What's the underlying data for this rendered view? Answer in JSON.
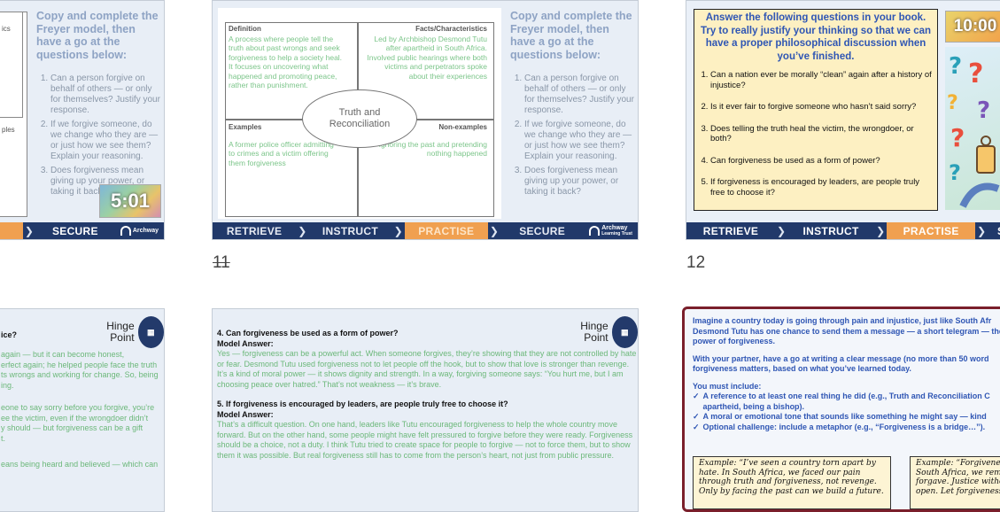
{
  "slide_numbers": {
    "left_mid": "11",
    "right_mid": "12"
  },
  "banner": {
    "retrieve": "RETRIEVE",
    "instruct": "INSTRUCT",
    "practise": "PRACTISE",
    "secure": "SECURE",
    "archway_line1": "Archway",
    "archway_line2": "Learning Trust"
  },
  "slide10": {
    "partial_labels": [
      "ics",
      "ples"
    ],
    "instruction": "Copy and complete the Freyer model, then have a go at the questions below:",
    "questions": [
      "Can a person forgive on behalf of others — or only for themselves? Justify your response.",
      "If we forgive someone, do we change who they are — or just how we see them? Explain your reasoning.",
      "Does forgiveness mean giving up your power, or taking it back?"
    ],
    "timer": "5:01"
  },
  "slide11": {
    "definition_label": "Definition",
    "definition_text": "A process where people tell the truth about past wrongs and seek forgiveness to help a society heal. It focuses on uncovering what happened and promoting peace, rather than punishment.",
    "facts_label": "Facts/Characteristics",
    "facts_text": "Led by Archbishop Desmond Tutu after apartheid in South Africa. Involved public hearings where both victims and perpetrators spoke about their experiences",
    "examples_label": "Examples",
    "examples_text": "A former police officer admitting to crimes and a victim offering them forgiveness",
    "nonexamples_label": "Non-examples",
    "nonexamples_text": "Ignoring the past and pretending nothing happened",
    "centre": "Truth and Reconciliation",
    "instruction": "Copy and complete the Freyer model, then have a go at the questions below:",
    "questions": [
      "Can a person forgive on behalf of others — or only for themselves? Justify your response.",
      "If we forgive someone, do we change who they are — or just how we see them? Explain your reasoning.",
      "Does forgiveness mean giving up your power, or taking it back?"
    ]
  },
  "slide12": {
    "heading": "Answer the following questions in your book. Try to really justify your thinking so that we can have a proper philosophical discussion when you’ve finished.",
    "questions": [
      "Can a nation ever be morally “clean” again after a history of injustice?",
      "Is it ever fair to forgive someone who hasn’t said sorry?",
      "Does telling the truth heal the victim, the wrongdoer, or both?",
      "Can forgiveness be used as a form of power?",
      "If forgiveness is encouraged by leaders, are people truly free to choose it?"
    ],
    "timer": "10:00"
  },
  "slide13": {
    "heading_partial": "ice?",
    "hinge": "Hinge Point",
    "lines": [
      "again — but it can become honest,",
      "erfect again; he helped people face the truth",
      "ts wrongs and working for change. So, being",
      "ing.",
      "",
      "eone to say sorry before you forgive, you’re",
      "ee the victim, even if the wrongdoer didn’t",
      "y should — but forgiveness can be a gift",
      "t.",
      "",
      "eans being heard and believed — which can"
    ]
  },
  "slide14": {
    "hinge": "Hinge Point",
    "q4": "4. Can forgiveness be used as a form of power?",
    "model_label": "Model Answer:",
    "a4": "Yes — forgiveness can be a powerful act. When someone forgives, they’re showing that they are not controlled by hate or fear. Desmond Tutu used forgiveness not to let people off the hook, but to show that love is stronger than revenge. It’s a kind of moral power — it shows dignity and strength. In a way, forgiving someone says: “You hurt me, but I am choosing peace over hatred.” That’s not weakness — it’s brave.",
    "q5": "5. If forgiveness is encouraged by leaders, are people truly free to choose it?",
    "a5": "That’s a difficult question. On one hand, leaders like Tutu encouraged forgiveness to help the whole country move forward. But on the other hand, some people might have felt pressured to forgive before they were ready. Forgiveness should be a choice, not a duty. I think Tutu tried to create space for people to forgive — not to force them, but to show them it was possible. But real forgiveness still has to come from the person’s heart, not just from public pressure."
  },
  "slide15": {
    "p1": "Imagine a country today is going through pain and injustice, just like South Afr Desmond Tutu has one chance to send them a message — a short telegram — the power of forgiveness.",
    "p2": "With your partner, have a go at writing a clear message (no more than 50 word forgiveness matters, based on what you’ve learned today.",
    "must": "You must include:",
    "bullets": [
      "A reference to at least one real thing he did (e.g., Truth and Reconciliation C apartheid, being a bishop).",
      "A moral or emotional tone that sounds like something he might say — kind",
      "Optional challenge: include a metaphor (e.g., “Forgiveness is a bridge…”)."
    ],
    "ex1": "Example: “I’ve seen a country torn apart by hate. In South Africa, we faced our pain through truth and forgiveness, not revenge. Only by facing the past can we build a future.",
    "ex2": "Example: “Forgiveness South Africa, we rem forgave. Justice witho open. Let forgiveness"
  },
  "colors": {
    "navy": "#21396a",
    "orange": "#f0a050",
    "green": "#6cb87a",
    "blue_text": "#2f56b4",
    "maroon": "#7a1f2b"
  }
}
